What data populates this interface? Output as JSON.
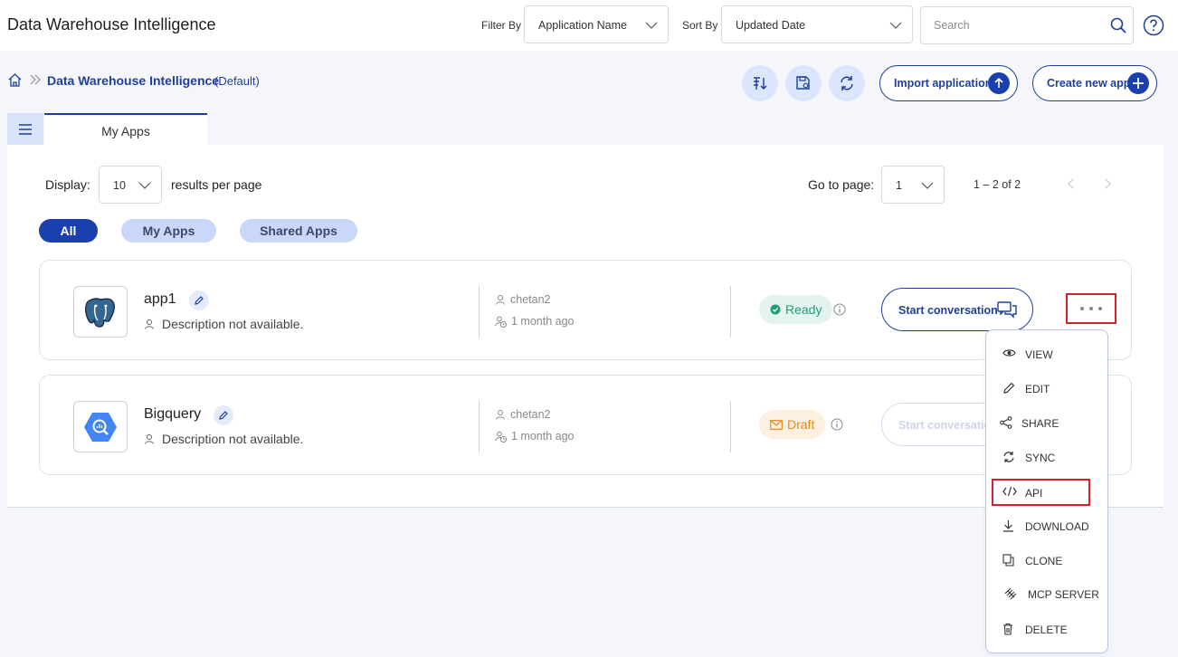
{
  "header": {
    "title": "Data Warehouse Intelligence",
    "filter_label": "Filter By",
    "filter_value": "Application Name",
    "sort_label": "Sort By",
    "sort_value": "Updated Date",
    "search_placeholder": "Search"
  },
  "breadcrumb": {
    "current": "Data Warehouse Intelligence",
    "tag": "(Default)"
  },
  "actions": {
    "import_label": "Import application",
    "create_label": "Create new app"
  },
  "tabs": [
    {
      "label": "My Apps"
    }
  ],
  "pagination": {
    "display_label": "Display:",
    "per_page_value": "10",
    "per_page_suffix": "results per page",
    "goto_label": "Go to page:",
    "page_value": "1",
    "range": "1 – 2 of 2"
  },
  "filters": [
    {
      "label": "All",
      "active": true
    },
    {
      "label": "My Apps",
      "active": false
    },
    {
      "label": "Shared Apps",
      "active": false
    }
  ],
  "apps": [
    {
      "name": "app1",
      "description": "Description not available.",
      "owner": "chetan2",
      "updated": "1 month ago",
      "status": "Ready",
      "status_color": "#1f9d7a",
      "action_label": "Start conversation",
      "logo_icon": "postgresql-icon"
    },
    {
      "name": "Bigquery",
      "description": "Description not available.",
      "owner": "chetan2",
      "updated": "1 month ago",
      "status": "Draft",
      "status_color": "#e08a1e",
      "action_label": "Start conversation",
      "logo_icon": "bigquery-icon"
    }
  ],
  "context_menu": {
    "items": [
      {
        "label": "VIEW",
        "icon": "eye-icon"
      },
      {
        "label": "EDIT",
        "icon": "pencil-icon"
      },
      {
        "label": "SHARE",
        "icon": "share-icon"
      },
      {
        "label": "SYNC",
        "icon": "sync-icon"
      },
      {
        "label": "API",
        "icon": "code-icon"
      },
      {
        "label": "DOWNLOAD",
        "icon": "download-icon"
      },
      {
        "label": "CLONE",
        "icon": "clone-icon"
      },
      {
        "label": "MCP SERVER",
        "icon": "mcp-icon"
      },
      {
        "label": "DELETE",
        "icon": "trash-icon"
      }
    ]
  },
  "colors": {
    "primary": "#1f3f9a",
    "accent": "#1a3fae",
    "highlight": "#d1222a"
  }
}
